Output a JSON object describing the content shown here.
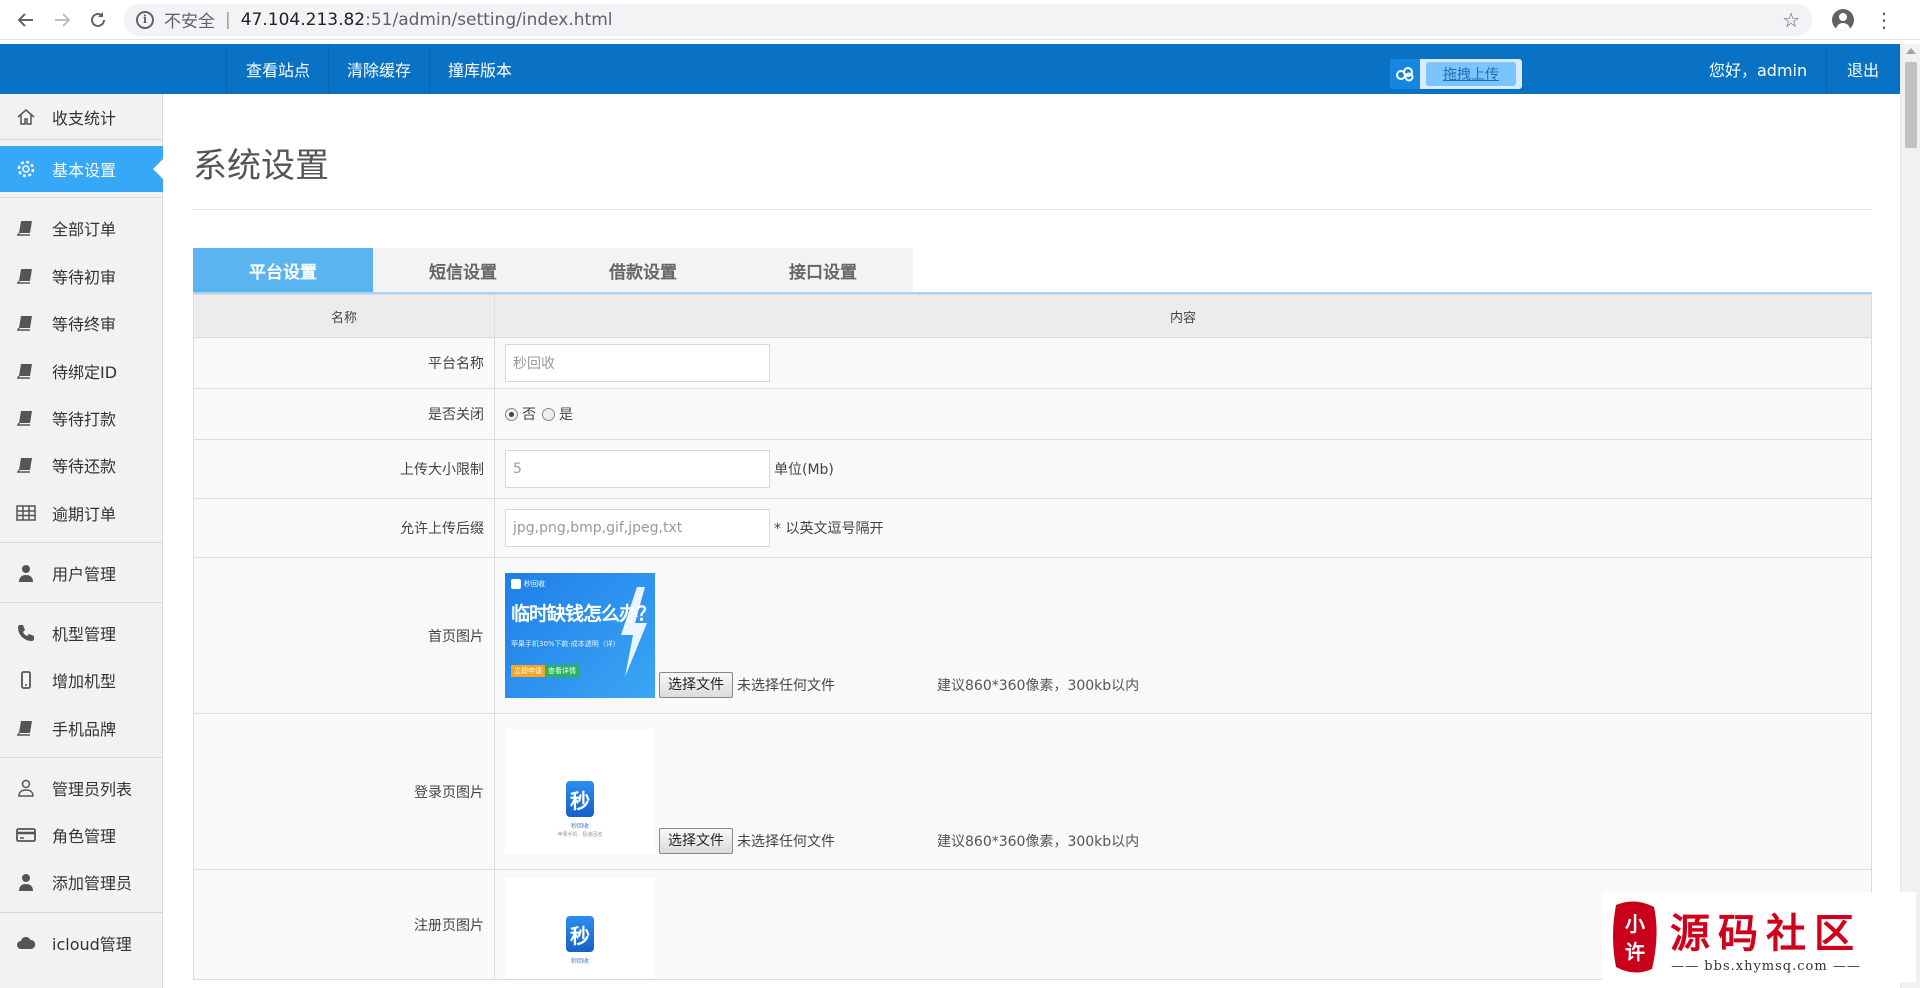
{
  "browser": {
    "insecure_label": "不安全",
    "url_host": "47.104.213.82",
    "url_rest": ":51/admin/setting/index.html"
  },
  "topnav": {
    "links": [
      "查看站点",
      "清除缓存",
      "撞库版本"
    ],
    "upload_button": "拖拽上传",
    "greeting": "您好，admin",
    "logout": "退出"
  },
  "sidebar": {
    "items": [
      {
        "label": "收支统计",
        "icon": "home-icon"
      },
      {
        "label": "基本设置",
        "icon": "gear-icon",
        "active": true
      },
      {
        "label": "全部订单",
        "icon": "book-icon"
      },
      {
        "label": "等待初审",
        "icon": "book-icon"
      },
      {
        "label": "等待终审",
        "icon": "book-icon"
      },
      {
        "label": "待绑定ID",
        "icon": "book-icon"
      },
      {
        "label": "等待打款",
        "icon": "book-icon"
      },
      {
        "label": "等待还款",
        "icon": "book-icon"
      },
      {
        "label": "逾期订单",
        "icon": "table-icon"
      },
      {
        "label": "用户管理",
        "icon": "user-icon"
      },
      {
        "label": "机型管理",
        "icon": "phone-icon"
      },
      {
        "label": "增加机型",
        "icon": "mobile-icon"
      },
      {
        "label": "手机品牌",
        "icon": "book-icon"
      },
      {
        "label": "管理员列表",
        "icon": "user-outline-icon"
      },
      {
        "label": "角色管理",
        "icon": "card-icon"
      },
      {
        "label": "添加管理员",
        "icon": "user-icon"
      },
      {
        "label": "icloud管理",
        "icon": "cloud-icon"
      }
    ]
  },
  "main": {
    "title": "系统设置",
    "tabs": [
      "平台设置",
      "短信设置",
      "借款设置",
      "接口设置"
    ],
    "table": {
      "headers": [
        "名称",
        "内容"
      ],
      "platform_name": {
        "label": "平台名称",
        "value": "秒回收"
      },
      "closed": {
        "label": "是否关闭",
        "option_no": "否",
        "option_yes": "是",
        "selected": "否"
      },
      "upload_limit": {
        "label": "上传大小限制",
        "value": "5",
        "unit": "单位(Mb)"
      },
      "allowed_ext": {
        "label": "允许上传后缀",
        "value": "jpg,png,bmp,gif,jpeg,txt",
        "note": "* 以英文逗号隔开"
      },
      "home_image": {
        "label": "首页图片",
        "banner_title": "临时缺钱怎么办？",
        "banner_sub": "苹果手机30%下款·成本透明（详）",
        "banner_brand": "秒回收",
        "btn_a": "立即申请",
        "btn_b": "查看详情"
      },
      "login_image": {
        "label": "登录页图片",
        "logo_char": "秒",
        "logo_caption": "秒回收",
        "logo_slogan": "苹果手机 · 极速回收"
      },
      "register_image": {
        "label": "注册页图片",
        "logo_char": "秒",
        "logo_caption": "秒回收"
      },
      "file_button": "选择文件",
      "file_none": "未选择任何文件",
      "image_hint": "建议860*360像素，300kb以内"
    }
  },
  "watermark": {
    "seal_text": "小许",
    "title": "源码社区",
    "site": "bbs.xhymsq.com"
  },
  "colors": {
    "topnav": "#0a72c4",
    "active": "#35a8f7",
    "tab_active": "#5ab4f0"
  }
}
